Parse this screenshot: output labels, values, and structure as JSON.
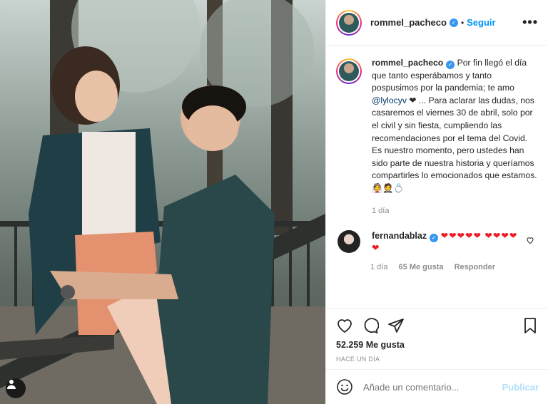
{
  "post": {
    "author": "rommel_pacheco",
    "follow_label": "Seguir",
    "dot": "•",
    "more": "•••"
  },
  "caption": {
    "author": "rommel_pacheco",
    "text_before_mention": "Por fin llegó el día que tanto esperábamos y tanto pospusimos por la pandemia; te amo ",
    "mention": "@lylocyv",
    "text_after_mention": " ❤ ... Para aclarar las dudas, nos casaremos el viernes 30 de abril, solo por el civil y sin fiesta, cumpliendo las recomendaciones por el tema del Covid. Es nuestro momento, pero ustedes han sido parte de nuestra historia y queríamos compartirles lo emocionados que estamos. 👰🤵💍",
    "time": "1 día"
  },
  "comment": {
    "author": "fernandablaz",
    "text": "❤❤❤❤❤ ❤❤❤❤❤",
    "time": "1 día",
    "likes": "65 Me gusta",
    "reply": "Responder"
  },
  "stats": {
    "likes": "52.259 Me gusta",
    "timestamp": "HACE UN DÍA"
  },
  "composer": {
    "placeholder": "Añade un comentario...",
    "post_label": "Publicar"
  },
  "icons": {
    "like": "heart-icon",
    "comment": "comment-icon",
    "share": "paper-plane-icon",
    "save": "bookmark-icon",
    "emoji": "smiley-icon",
    "verified": "verified-badge-icon",
    "tag": "user-tag-icon"
  },
  "colors": {
    "link_blue": "#0095f6",
    "mention_blue": "#00376b",
    "heart_red": "#ed1c24",
    "muted": "#8e8e8e",
    "verified": "#3897f0"
  }
}
